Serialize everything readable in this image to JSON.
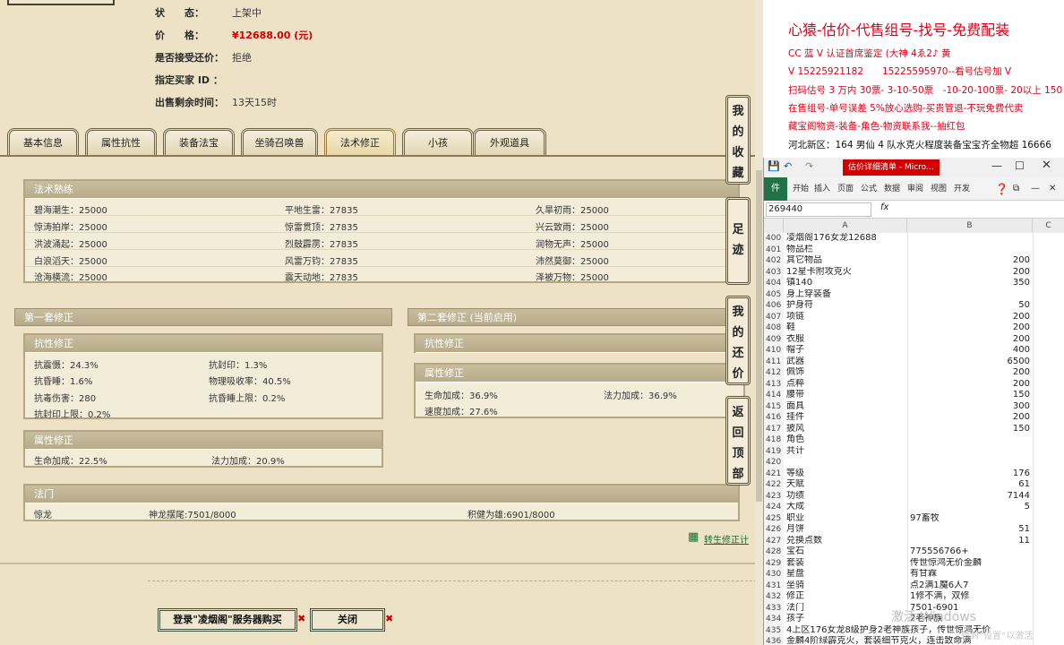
{
  "listing": {
    "status_label": "状　　态：",
    "status_value": "上架中",
    "price_label": "价　　格：",
    "price_value": "¥12688.00 (元)",
    "counter_label": "是否接受还价：",
    "counter_value": "拒绝",
    "buyer_label": "指定买家 ID ：",
    "remaining_label": "出售剩余时间：",
    "remaining_value": "13天15时"
  },
  "tabs": [
    {
      "label": "基本信息"
    },
    {
      "label": "属性抗性"
    },
    {
      "label": "装备法宝"
    },
    {
      "label": "坐骑召唤兽"
    },
    {
      "label": "法术修正"
    },
    {
      "label": "小孩"
    },
    {
      "label": "外观道具"
    }
  ],
  "spell_mastery": {
    "title": "法术熟练",
    "rows": [
      [
        "碧海潮生：25000",
        "平地生雷：27835",
        "久旱初雨：25000"
      ],
      [
        "惊涛拍岸：25000",
        "惊雷贯顶：27835",
        "兴云致雨：25000"
      ],
      [
        "洪波涌起：25000",
        "烈鼓霹雳：27835",
        "润物无声：25000"
      ],
      [
        "白浪滔天：25000",
        "风雷万钧：27835",
        "沛然莫御：25000"
      ],
      [
        "沧海横流：25000",
        "震天动地：27835",
        "泽被万物：25000"
      ]
    ]
  },
  "set1": {
    "title": "第一套修正",
    "resist_title": "抗性修正",
    "resist": [
      [
        "抗震慑：24.3%",
        "抗封印：1.3%"
      ],
      [
        "抗昏睡：1.6%",
        "物理吸收率：40.5%"
      ],
      [
        "抗毒伤害：280",
        "抗昏睡上限：0.2%"
      ],
      [
        "抗封印上限：0.2%",
        ""
      ]
    ],
    "attr_title": "属性修正",
    "attr": [
      "生命加成：22.5%",
      "法力加成：20.9%"
    ]
  },
  "set2": {
    "title": "第二套修正 (当前启用)",
    "resist_title": "抗性修正",
    "attr_title": "属性修正",
    "attr": [
      [
        "生命加成：36.9%",
        "法力加成：36.9%"
      ],
      [
        "速度加成：27.6%",
        ""
      ]
    ]
  },
  "fashu": {
    "title": "法门",
    "items": [
      "惊龙",
      "神龙摆尾:7501/8000",
      "积健为雄:6901/8000"
    ]
  },
  "rebirth_link": "转生修正计",
  "side_buttons": [
    {
      "label": [
        "我",
        "的",
        "收",
        "藏"
      ]
    },
    {
      "label": [
        "足",
        "迹"
      ]
    },
    {
      "label": [
        "我",
        "的",
        "还",
        "价"
      ]
    },
    {
      "label": [
        "返",
        "回",
        "顶",
        "部"
      ]
    }
  ],
  "bottom": {
    "buy_label": "登录\"凌烟阁\"服务器购买",
    "close_label": "关闭"
  },
  "ad": {
    "headline": "心猿-估价-代售组号-找号-免费配装",
    "lines": [
      "CC 蓝 V 认证首席鉴定 (大神 4ゑ2♪ 黄",
      "V 15225921182　　15225595970--看号估号加 V",
      "扫码估号 3 万内 30票- 3-10-50票　-10-20-100票- 20以上 150",
      "在售组号-单号误差 5%放心选购-买贵管退-不玩免费代卖",
      "藏宝阁物资-装备-角色-物资联系我--抽红包"
    ],
    "note": "河北新区：164 男仙 4 队水克火程度装备宝宝齐全物超 16666"
  },
  "excel": {
    "tab_title": "估价详细清单 - Micro...",
    "ribbon_file": "件",
    "ribbon_items": [
      "开始",
      "插入",
      "页面",
      "公式",
      "数据",
      "审阅",
      "视图",
      "开发"
    ],
    "namebox": "269440",
    "fx": "fx",
    "col_a": "A",
    "col_b": "B",
    "col_c": "C",
    "rows": [
      [
        "400",
        "凌烟阁176女龙12688",
        ""
      ],
      [
        "401",
        "物品栏",
        ""
      ],
      [
        "402",
        "其它物品",
        "200"
      ],
      [
        "403",
        "12星卡附攻克火",
        "200"
      ],
      [
        "404",
        "镇140",
        "350"
      ],
      [
        "405",
        "身上穿装备",
        ""
      ],
      [
        "406",
        "护身符",
        "50"
      ],
      [
        "407",
        "项链",
        "200"
      ],
      [
        "408",
        "鞋",
        "200"
      ],
      [
        "409",
        "衣服",
        "200"
      ],
      [
        "410",
        "帽子",
        "400"
      ],
      [
        "411",
        "武器",
        "6500"
      ],
      [
        "412",
        "佩饰",
        "200"
      ],
      [
        "413",
        "点粹",
        "200"
      ],
      [
        "414",
        "腰带",
        "150"
      ],
      [
        "415",
        "面具",
        "300"
      ],
      [
        "416",
        "挂件",
        "200"
      ],
      [
        "417",
        "披风",
        "150"
      ],
      [
        "418",
        "角色",
        ""
      ],
      [
        "419",
        "共计",
        ""
      ],
      [
        "420",
        "",
        ""
      ],
      [
        "421",
        "等级",
        "176"
      ],
      [
        "422",
        "天赋",
        "61"
      ],
      [
        "423",
        "功绩",
        "7144"
      ],
      [
        "424",
        "大成",
        "5"
      ],
      [
        "425",
        "职业",
        "97畜牧"
      ],
      [
        "426",
        "月饼",
        "51"
      ],
      [
        "427",
        "兑换点数",
        "11"
      ],
      [
        "428",
        "宝石",
        "775556766+"
      ],
      [
        "429",
        "套装",
        "传世惊鸿无价金麟"
      ],
      [
        "430",
        "星盘",
        "有甘霖"
      ],
      [
        "431",
        "坐骑",
        "点2满1魔6人7"
      ],
      [
        "432",
        "修正",
        "1修不满，双修"
      ],
      [
        "433",
        "法门",
        "7501-6901"
      ],
      [
        "434",
        "孩子",
        "2老神族"
      ],
      [
        "435",
        "4上区176女龙8级护身2老神族孩子，传世惊鸿无价",
        ""
      ],
      [
        "436",
        "金麟4阶绿霹克火，套装细节克火，连击致命满",
        ""
      ]
    ],
    "watermark": "激活 Windows",
    "watermark2": "转到“设置”以激活 Windows。"
  }
}
